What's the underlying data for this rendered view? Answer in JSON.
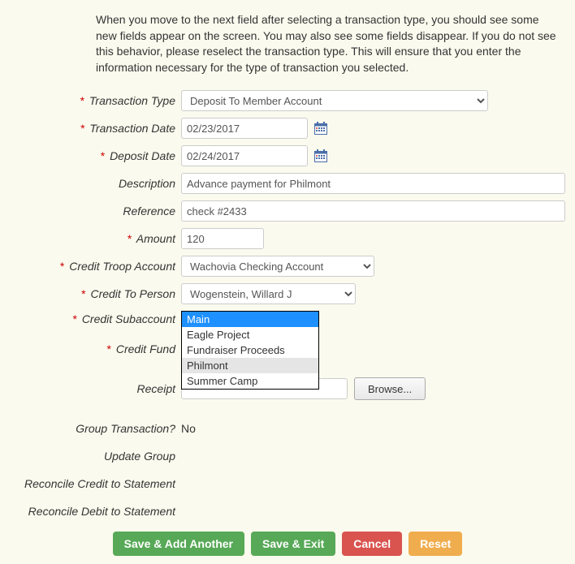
{
  "intro": "When you move to the next field after selecting a transaction type, you should see some new fields appear on the screen. You may also see some fields disappear. If you do not see this behavior, please reselect the transaction type. This will ensure that you enter the information necessary for the type of transaction you selected.",
  "labels": {
    "transaction_type": "Transaction Type",
    "transaction_date": "Transaction Date",
    "deposit_date": "Deposit Date",
    "description": "Description",
    "reference": "Reference",
    "amount": "Amount",
    "credit_troop_account": "Credit Troop Account",
    "credit_to_person": "Credit To Person",
    "credit_subaccount": "Credit Subaccount",
    "credit_fund": "Credit Fund",
    "receipt": "Receipt",
    "group_transaction": "Group Transaction?",
    "update_group": "Update Group",
    "reconcile_credit": "Reconcile Credit to Statement",
    "reconcile_debit": "Reconcile Debit to Statement"
  },
  "values": {
    "transaction_type": "Deposit To Member Account",
    "transaction_date": "02/23/2017",
    "deposit_date": "02/24/2017",
    "description": "Advance payment for Philmont",
    "reference": "check #2433",
    "amount": "120",
    "credit_troop_account": "Wachovia Checking Account",
    "credit_to_person": "Wogenstein, Willard J",
    "group_transaction": "No",
    "receipt_path": ""
  },
  "subaccount_options": [
    "Main",
    "Eagle Project",
    "Fundraiser Proceeds",
    "Philmont",
    "Summer Camp"
  ],
  "subaccount_selected": "Main",
  "subaccount_hover": "Philmont",
  "buttons": {
    "browse": "Browse...",
    "save_add_another": "Save & Add Another",
    "save_exit": "Save & Exit",
    "cancel": "Cancel",
    "reset": "Reset"
  },
  "colors": {
    "btn_green": "#57a957",
    "btn_red": "#d9534f",
    "btn_orange": "#f0ad4e"
  }
}
